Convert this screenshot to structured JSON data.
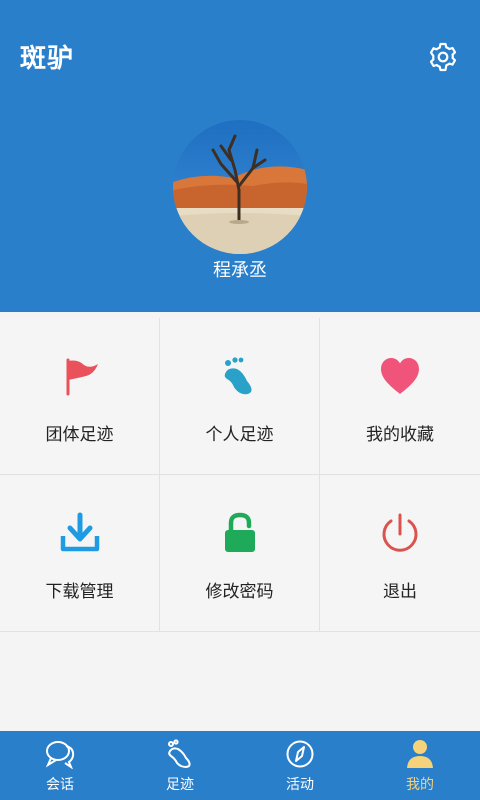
{
  "app": {
    "logo_text": "斑驴",
    "settings_icon": "gear-icon"
  },
  "profile": {
    "username": "程承丞",
    "avatar": "desert-tree-photo"
  },
  "menu": [
    {
      "label": "团体足迹",
      "icon": "flag-icon",
      "color": "#e9525b"
    },
    {
      "label": "个人足迹",
      "icon": "footprint-icon",
      "color": "#2aa1c9"
    },
    {
      "label": "我的收藏",
      "icon": "heart-icon",
      "color": "#f1547a"
    },
    {
      "label": "下载管理",
      "icon": "download-icon",
      "color": "#1e9be3"
    },
    {
      "label": "修改密码",
      "icon": "lock-icon",
      "color": "#1faa5a"
    },
    {
      "label": "退出",
      "icon": "power-icon",
      "color": "#d9544f"
    }
  ],
  "nav": [
    {
      "label": "会话",
      "icon": "chat-icon"
    },
    {
      "label": "足迹",
      "icon": "footprint-nav-icon"
    },
    {
      "label": "活动",
      "icon": "compass-icon"
    },
    {
      "label": "我的",
      "icon": "user-icon",
      "active": true
    }
  ],
  "colors": {
    "primary": "#2a7fcb",
    "active_nav": "#f6d27a"
  }
}
